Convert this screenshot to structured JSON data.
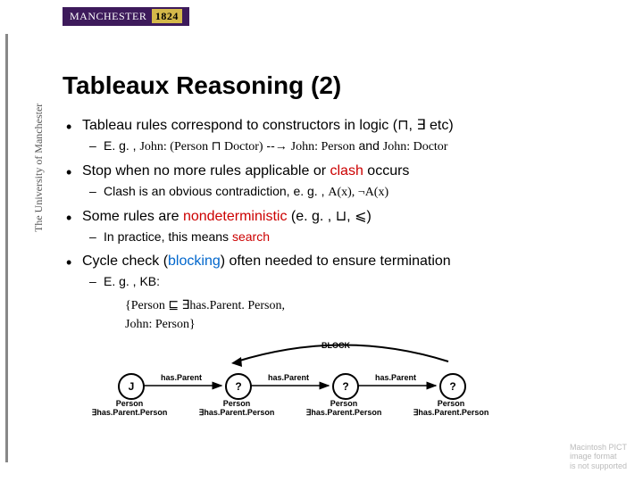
{
  "logo": {
    "name": "MANCHESTER",
    "year": "1824"
  },
  "sidebar_text": "The University of Manchester",
  "title": "Tableaux Reasoning (2)",
  "bullets": {
    "b1": {
      "text_pre": "Tableau rules correspond to constructors in logic (",
      "sym1": "⊓",
      "mid": ", ",
      "sym2": "∃",
      "text_post": " etc)",
      "sub": {
        "pre": "E. g. , ",
        "expr1": "John: (Person ⊓ Doctor)",
        "arrow": " --→ ",
        "expr2": "John: Person",
        "and": " and ",
        "expr3": "John: Doctor"
      }
    },
    "b2": {
      "text_pre": "Stop when no more rules applicable or ",
      "clash": "clash",
      "text_post": " occurs",
      "sub": {
        "pre": "Clash is an obvious contradiction, e. g. , ",
        "expr": "A(x), ¬A(x)"
      }
    },
    "b3": {
      "text_pre": "Some rules are ",
      "nondet": "nondeterministic",
      "text_mid": " (e. g. , ",
      "sym1": "⊔",
      "sep": ", ",
      "sym2": "⩽",
      "text_post": ")",
      "sub": {
        "pre": "In practice, this means ",
        "search": "search"
      }
    },
    "b4": {
      "text_pre": "Cycle check (",
      "blocking": "blocking",
      "text_post": ") often needed to ensure termination",
      "sub": {
        "pre": "E. g. , KB:"
      },
      "kb": {
        "line1": "{Person ⊑ ∃has.Parent. Person,",
        "line2": " John: Person}"
      }
    }
  },
  "diagram": {
    "block": "BLOCK",
    "j": "J",
    "q": "?",
    "edge": "has.Parent",
    "label_top": "Person",
    "label_bot": "∃has.Parent.Person"
  },
  "placeholder": {
    "l1": "Macintosh PICT",
    "l2": "image format",
    "l3": "is not supported"
  }
}
